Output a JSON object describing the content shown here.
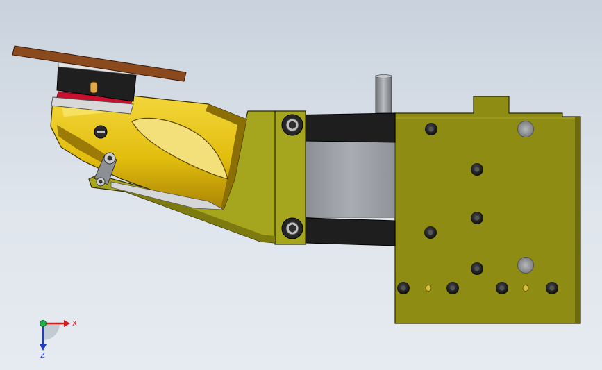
{
  "colors": {
    "background_top": "#c9d2dd",
    "background_bottom": "#e6ebf1",
    "plate_olive": "#8f8c14",
    "plate_olive_dark": "#6d6a0c",
    "bracket_olive": "#a6a61e",
    "grip_yellow": "#e6c310",
    "grip_yellow_dark": "#b48f06",
    "link_black": "#1e1e1e",
    "gray_body": "#9a9ea3",
    "disk_brown": "#8a4a1e",
    "seal_red": "#c8102e",
    "axis_x": "#d21e1e",
    "axis_y": "#1fb14a",
    "axis_z": "#1e3cc8"
  },
  "triad": {
    "x_label": "X",
    "z_label": "Z"
  }
}
